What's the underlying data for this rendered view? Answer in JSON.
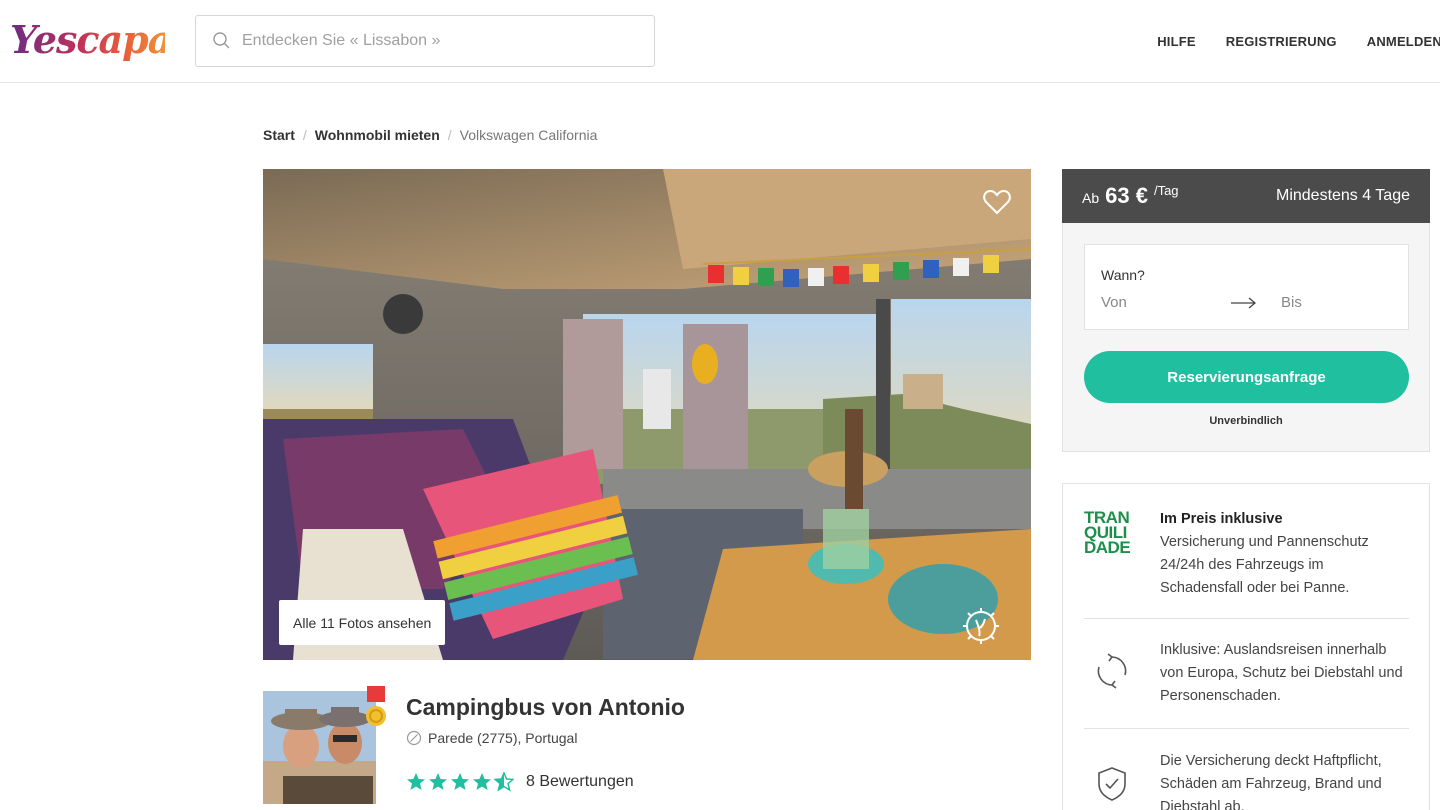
{
  "header": {
    "logo_text": "Yescapa",
    "search_placeholder": "Entdecken Sie « Lissabon »",
    "nav": [
      "HILFE",
      "REGISTRIERUNG",
      "ANMELDEN"
    ]
  },
  "breadcrumb": {
    "items": [
      "Start",
      "Wohnmobil mieten"
    ],
    "current": "Volkswagen California"
  },
  "gallery": {
    "photos_button_label": "Alle 11 Fotos ansehen"
  },
  "listing": {
    "title": "Campingbus von Antonio",
    "location": "Parede (2775), Portugal",
    "rating_stars": 4.5,
    "reviews_label": "8 Bewertungen"
  },
  "booking": {
    "price_prefix": "Ab",
    "price": "63 €",
    "price_unit": "/Tag",
    "minimum": "Mindestens 4 Tage",
    "when_label": "Wann?",
    "from_label": "Von",
    "to_label": "Bis",
    "reserve_label": "Reservierungsanfrage",
    "nonbinding_label": "Unverbindlich"
  },
  "insurance": {
    "logo_lines": [
      "TRAN",
      "QUILI",
      "DADE"
    ],
    "items": [
      {
        "title": "Im Preis inklusive",
        "text": "Versicherung und Pannenschutz 24/24h des Fahrzeugs im Schadensfall oder bei Panne."
      },
      {
        "title": "",
        "text": "Inklusive: Auslandsreisen innerhalb von Europa, Schutz bei Diebstahl und Personenschaden."
      },
      {
        "title": "",
        "text": "Die Versicherung deckt Haftpflicht, Schäden am Fahrzeug, Brand und Diebstahl ab."
      }
    ]
  },
  "colors": {
    "accent": "#1fbf9f",
    "price_bar": "#4b4b4b",
    "star": "#1fbf9f",
    "tranquilidade": "#1e8f4a"
  }
}
